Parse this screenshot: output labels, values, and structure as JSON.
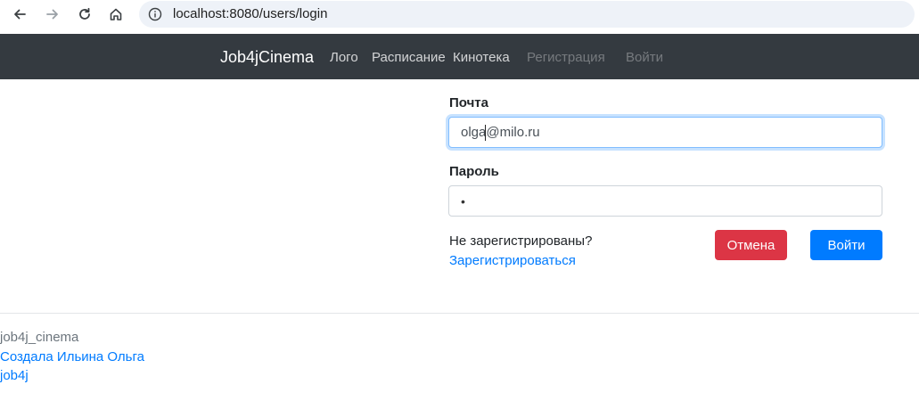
{
  "browser": {
    "url": "localhost:8080/users/login",
    "icons": [
      "back-arrow-icon",
      "forward-arrow-icon",
      "reload-icon",
      "home-icon",
      "info-icon"
    ]
  },
  "navbar": {
    "brand": "Job4jCinema",
    "links": [
      {
        "label": "Лого",
        "state": "active"
      },
      {
        "label": "Расписание",
        "state": "active"
      },
      {
        "label": "Кинотека",
        "state": "active"
      },
      {
        "label": "Регистрация",
        "state": "disabled"
      },
      {
        "label": "Войти",
        "state": "disabled"
      }
    ]
  },
  "form": {
    "email_label": "Почта",
    "email_value_before_caret": "olga",
    "email_value_after_caret": "@milo.ru",
    "password_label": "Пароль",
    "password_mask": "•",
    "question": "Не зарегистрированы?",
    "register_link": "Зарегистрироваться",
    "cancel_label": "Отмена",
    "login_label": "Войти"
  },
  "footer": {
    "title": "job4j_cinema",
    "author_link": "Создала Ильина Ольга",
    "site_link": "job4j"
  },
  "colors": {
    "navbar_bg": "#343a40",
    "primary": "#007bff",
    "danger": "#dc3545"
  }
}
